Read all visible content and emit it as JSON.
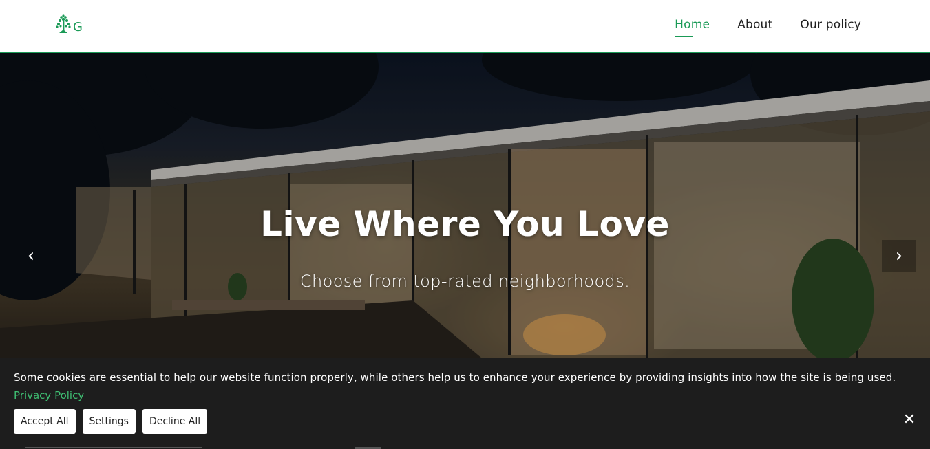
{
  "nav": {
    "items": [
      {
        "label": "Home",
        "active": true
      },
      {
        "label": "About",
        "active": false
      },
      {
        "label": "Our policy",
        "active": false
      }
    ]
  },
  "logo": {
    "icon": "tree-logo-icon",
    "letters": "G"
  },
  "hero": {
    "title": "Live Where You Love",
    "subtitle": "Choose from top-rated neighborhoods.",
    "prev_glyph": "‹",
    "next_glyph": "›"
  },
  "cookie": {
    "message": "Some cookies are essential to help our website function properly, while others help us to enhance your experience by providing insights into how the site is being used.",
    "link": "Privacy Policy",
    "buttons": {
      "accept": "Accept All",
      "settings": "Settings",
      "decline": "Decline All"
    },
    "close_glyph": "✕"
  },
  "colors": {
    "accent": "#1a9a56",
    "banner_bg": "#1d1d1d",
    "link": "#3fbf73"
  }
}
